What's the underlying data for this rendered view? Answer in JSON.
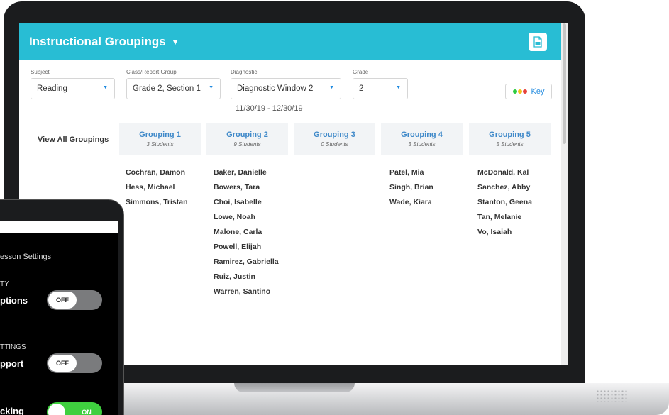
{
  "header": {
    "title": "Instructional Groupings"
  },
  "filters": {
    "subject_label": "Subject",
    "subject_value": "Reading",
    "class_label": "Class/Report Group",
    "class_value": "Grade 2, Section 1",
    "diagnostic_label": "Diagnostic",
    "diagnostic_value": "Diagnostic Window 2",
    "diagnostic_dates": "11/30/19 - 12/30/19",
    "grade_label": "Grade",
    "grade_value": "2",
    "key_label": "Key",
    "key_colors": [
      "#2ecc40",
      "#f2c21b",
      "#e8423b"
    ]
  },
  "view_all_label": "View All Groupings",
  "groupings": [
    {
      "title": "Grouping 1",
      "count": "3 Students",
      "students": [
        "Cochran, Damon",
        "Hess, Michael",
        "Simmons, Tristan"
      ]
    },
    {
      "title": "Grouping 2",
      "count": "9 Students",
      "students": [
        "Baker, Danielle",
        "Bowers, Tara",
        "Choi, Isabelle",
        "Lowe, Noah",
        "Malone, Carla",
        "Powell, Elijah",
        "Ramirez, Gabriella",
        "Ruiz, Justin",
        "Warren, Santino"
      ]
    },
    {
      "title": "Grouping 3",
      "count": "0 Students",
      "students": []
    },
    {
      "title": "Grouping 4",
      "count": "3 Students",
      "students": [
        "Patel, Mia",
        "Singh, Brian",
        "Wade, Kiara"
      ]
    },
    {
      "title": "Grouping 5",
      "count": "5 Students",
      "students": [
        "McDonald, Kal",
        "Sanchez, Abby",
        "Stanton, Geena",
        "Tan, Melanie",
        "Vo, Isaiah"
      ]
    }
  ],
  "tablet": {
    "lesson_title": "esson Settings",
    "section1": "TY",
    "setting1": "ptions",
    "toggle1": "OFF",
    "section2": "TTINGS",
    "setting2": "pport",
    "toggle2": "OFF",
    "setting3": "cking",
    "toggle3": "ON"
  },
  "colors": {
    "header": "#28bdd4",
    "group_title": "#3f89c9",
    "toggle_on": "#3fcf3f"
  }
}
